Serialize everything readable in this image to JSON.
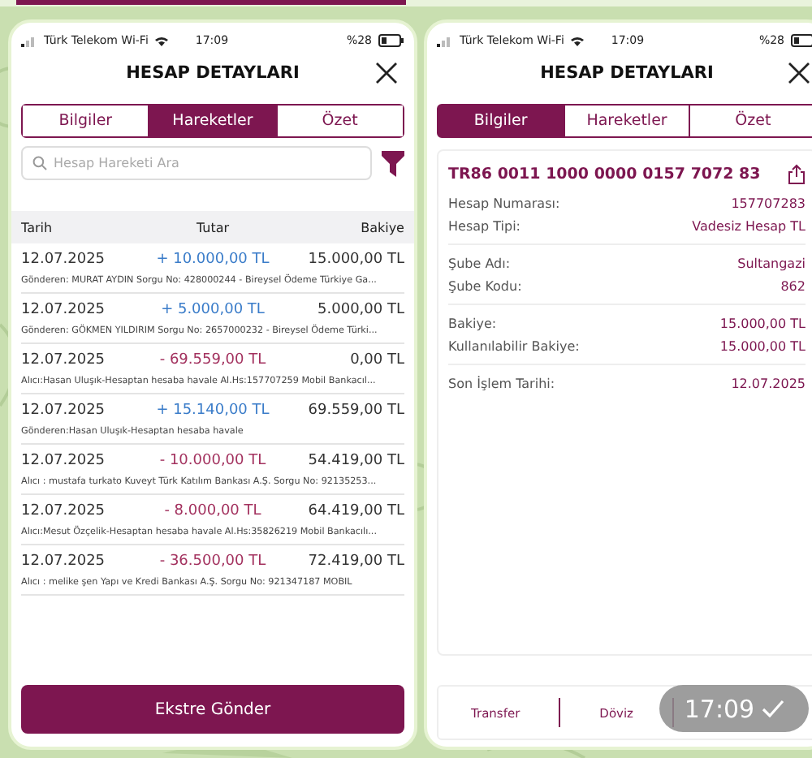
{
  "left_screen": {
    "status_bar": {
      "carrier": "Türk Telekom Wi-Fi",
      "time": "17:09",
      "battery": "%28"
    },
    "title": "HESAP DETAYLARI",
    "tabs": [
      {
        "label": "Bilgiler",
        "selected": false
      },
      {
        "label": "Hareketler",
        "selected": true
      },
      {
        "label": "Özet",
        "selected": false
      }
    ],
    "search": {
      "placeholder": "Hesap Hareketi Ara"
    },
    "table": {
      "columns": [
        "Tarih",
        "Tutar",
        "Bakiye"
      ],
      "rows": [
        {
          "date": "12.07.2025",
          "amount": "+ 10.000,00 TL",
          "kind": "credit",
          "balance": "15.000,00 TL",
          "description": "Gönderen: MURAT AYDIN Sorgu No: 428000244 - Bireysel Ödeme Türkiye Ga..."
        },
        {
          "date": "12.07.2025",
          "amount": "+ 5.000,00 TL",
          "kind": "credit",
          "balance": "5.000,00 TL",
          "description": "Gönderen: GÖKMEN YILDIRIM Sorgu No: 2657000232 - Bireysel Ödeme Türki..."
        },
        {
          "date": "12.07.2025",
          "amount": "- 69.559,00 TL",
          "kind": "debit",
          "balance": "0,00 TL",
          "description": "Alıcı:Hasan Uluşık-Hesaptan hesaba havale Al.Hs:157707259 Mobil Bankacıl..."
        },
        {
          "date": "12.07.2025",
          "amount": "+ 15.140,00 TL",
          "kind": "credit",
          "balance": "69.559,00 TL",
          "description": "Gönderen:Hasan Uluşık-Hesaptan hesaba havale"
        },
        {
          "date": "12.07.2025",
          "amount": "- 10.000,00 TL",
          "kind": "debit",
          "balance": "54.419,00 TL",
          "description": "Alıcı : mustafa turkato Kuveyt Türk Katılım Bankası A.Ş. Sorgu No: 92135253..."
        },
        {
          "date": "12.07.2025",
          "amount": "- 8.000,00 TL",
          "kind": "debit",
          "balance": "64.419,00 TL",
          "description": "Alıcı:Mesut Özçelik-Hesaptan hesaba havale Al.Hs:35826219 Mobil Bankacılı..."
        },
        {
          "date": "12.07.2025",
          "amount": "- 36.500,00 TL",
          "kind": "debit",
          "balance": "72.419,00 TL",
          "description": "Alıcı : melike şen Yapı ve Kredi Bankası A.Ş. Sorgu No: 921347187 MOBIL"
        }
      ]
    },
    "primary_button": "Ekstre Gönder"
  },
  "right_screen": {
    "status_bar": {
      "carrier": "Türk Telekom Wi-Fi",
      "time": "17:09",
      "battery": "%28"
    },
    "title": "HESAP DETAYLARI",
    "tabs": [
      {
        "label": "Bilgiler",
        "selected": true
      },
      {
        "label": "Hareketler",
        "selected": false
      },
      {
        "label": "Özet",
        "selected": false
      }
    ],
    "iban": "TR86 0011 1000 0000 0157 7072 83",
    "groups": [
      [
        {
          "label": "Hesap Numarası:",
          "value": "157707283"
        },
        {
          "label": "Hesap Tipi:",
          "value": "Vadesiz Hesap TL"
        }
      ],
      [
        {
          "label": "Şube Adı:",
          "value": "Sultangazi"
        },
        {
          "label": "Şube Kodu:",
          "value": "862"
        }
      ],
      [
        {
          "label": "Bakiye:",
          "value": "15.000,00 TL"
        },
        {
          "label": "Kullanılabilir Bakiye:",
          "value": "15.000,00 TL"
        }
      ],
      [
        {
          "label": "Son İşlem Tarihi:",
          "value": "12.07.2025"
        }
      ]
    ],
    "bottom_actions": [
      "Transfer",
      "Döviz"
    ]
  },
  "message_time": "17:09"
}
